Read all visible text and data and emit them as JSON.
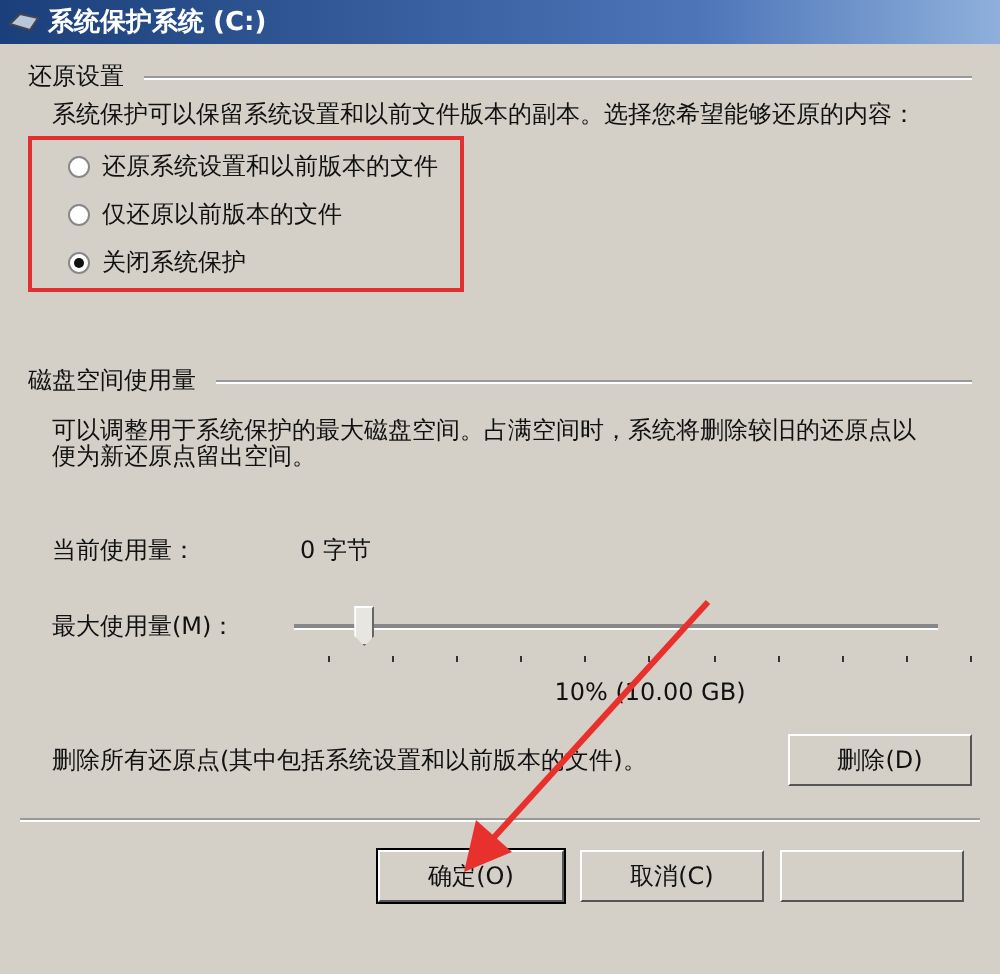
{
  "window": {
    "title": "系统保护系统 (C:)"
  },
  "restore_settings": {
    "heading": "还原设置",
    "description": "系统保护可以保留系统设置和以前文件版本的副本。选择您希望能够还原的内容：",
    "options": [
      {
        "label": "还原系统设置和以前版本的文件",
        "selected": false
      },
      {
        "label": "仅还原以前版本的文件",
        "selected": false
      },
      {
        "label": "关闭系统保护",
        "selected": true
      }
    ]
  },
  "disk_usage": {
    "heading": "磁盘空间使用量",
    "description": "可以调整用于系统保护的最大磁盘空间。占满空间时，系统将删除较旧的还原点以便为新还原点留出空间。",
    "current_label": "当前使用量：",
    "current_value": "0 字节",
    "max_label": "最大使用量(M)：",
    "max_slider": {
      "level": 0.1
    },
    "max_reading": "10% (10.00 GB)",
    "delete_text": "删除所有还原点(其中包括系统设置和以前版本的文件)。",
    "delete_button": "删除(D)"
  },
  "buttons": [
    {
      "label": "确定(O)",
      "selected": true
    },
    {
      "label": "取消(C)",
      "selected": false
    },
    {
      "selected": false
    }
  ]
}
